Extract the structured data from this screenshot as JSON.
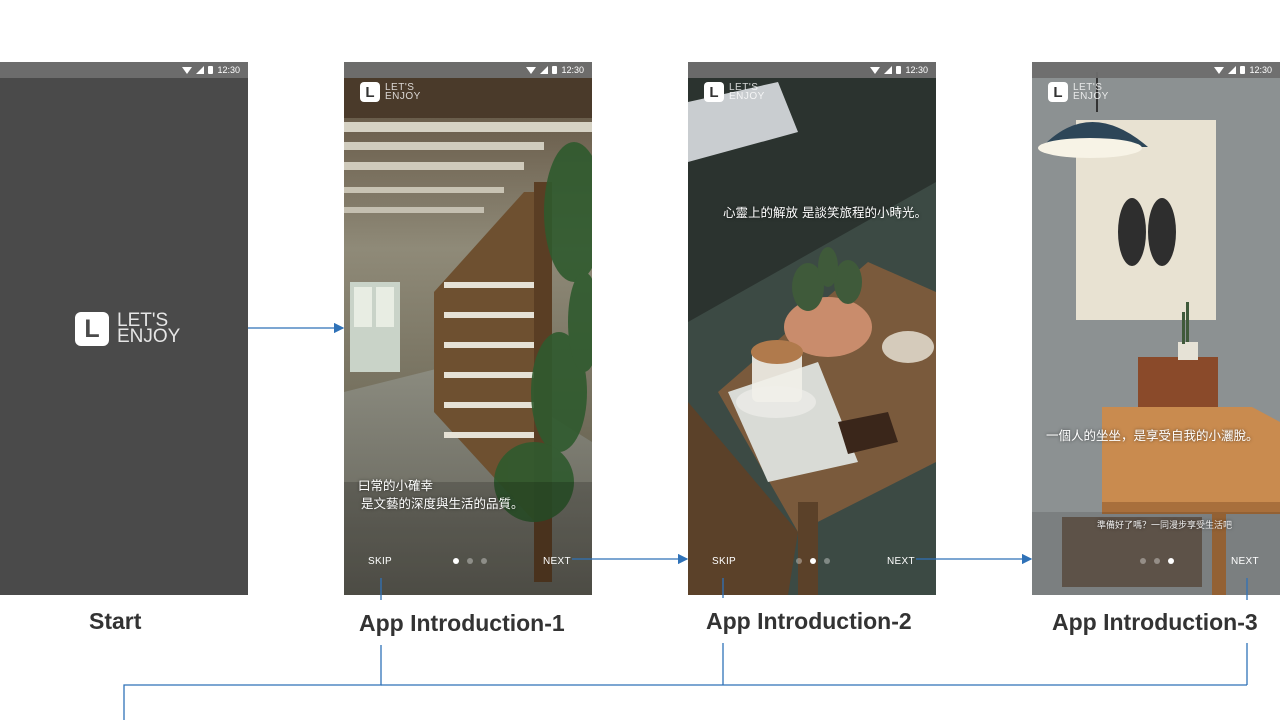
{
  "statusbar": {
    "time": "12:30"
  },
  "logo": {
    "letter": "L",
    "line1": "LET'S",
    "line2": "ENJOY"
  },
  "screens": {
    "start": {
      "label": "Start",
      "logo": {
        "letter": "L",
        "line1": "LET'S",
        "line2": "ENJOY"
      }
    },
    "intro1": {
      "label": "App Introduction-1",
      "caption_line1": "曰常的小確幸",
      "caption_line2": "是文藝的深度與生活的品質。",
      "skip": "SKIP",
      "next": "NEXT",
      "active_page": 1
    },
    "intro2": {
      "label": "App Introduction-2",
      "caption": "心靈上的解放 是談笑旅程的小時光。",
      "skip": "SKIP",
      "next": "NEXT",
      "active_page": 2
    },
    "intro3": {
      "label": "App Introduction-3",
      "caption": "一個人的坐坐，是享受自我的小灑脫。",
      "subcaption": "準備好了嗎？一同漫步享受生活吧",
      "next": "NEXT",
      "active_page": 3
    }
  },
  "colors": {
    "connector": "#2f72b8",
    "label": "#333333",
    "start_bg": "#4a4a4a"
  }
}
